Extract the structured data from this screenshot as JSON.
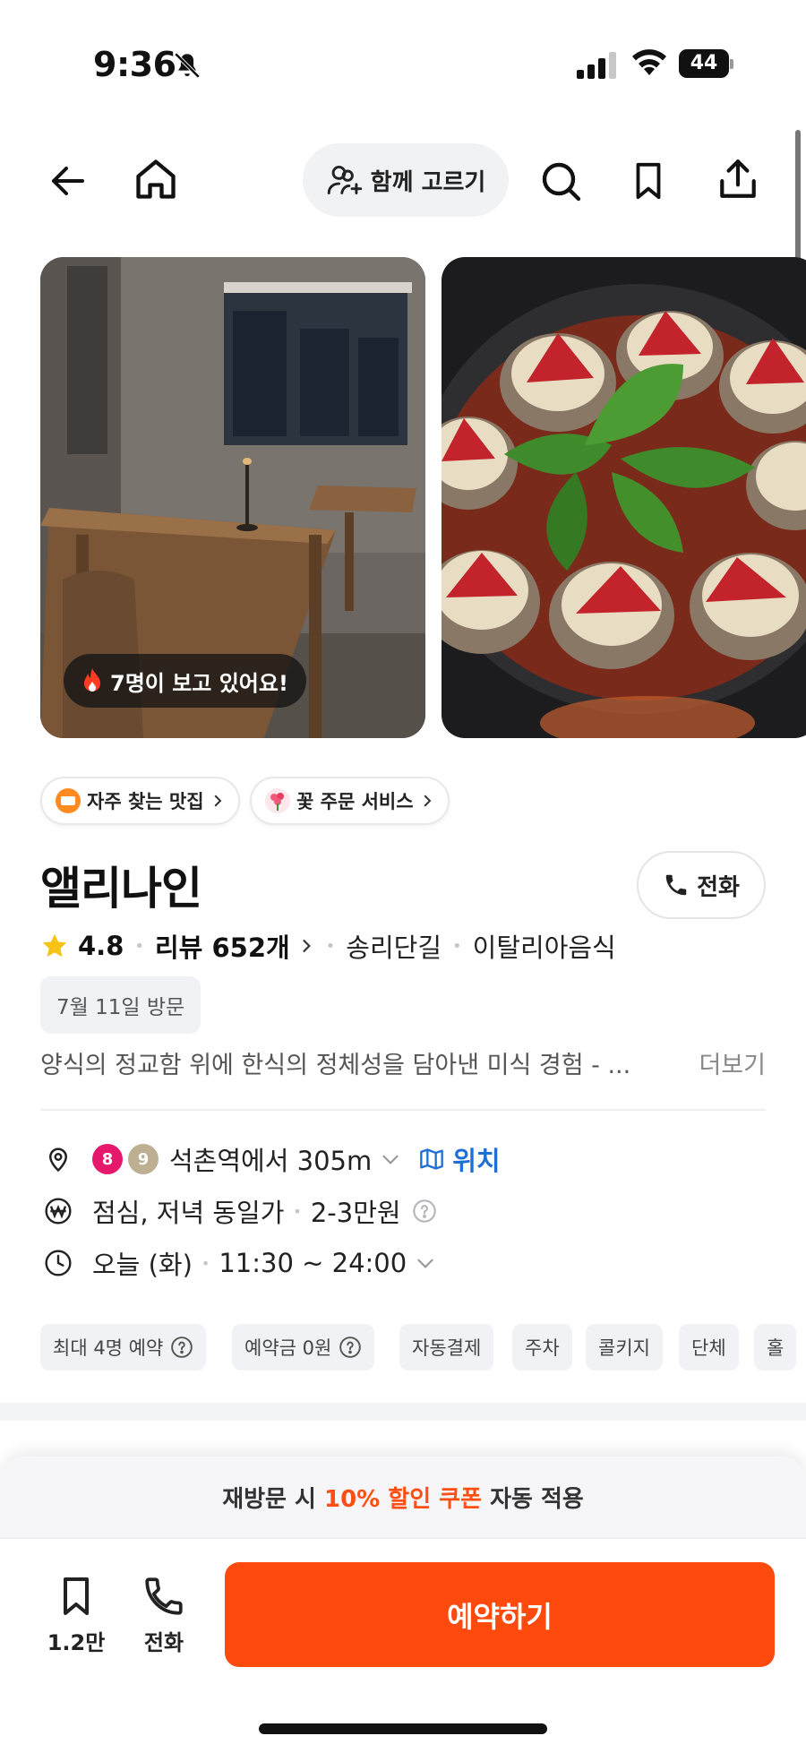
{
  "status_bar": {
    "time": "9:36",
    "battery": "44"
  },
  "nav": {
    "together_label": "함께 고르기"
  },
  "photos": {
    "viewers_text": "7명이 보고 있어요!"
  },
  "chips": [
    {
      "label": "자주 찾는 맛집"
    },
    {
      "label": "꽃 주문 서비스"
    }
  ],
  "restaurant": {
    "name": "앨리나인",
    "call_label": "전화",
    "rating": "4.8",
    "review_text": "리뷰 652개",
    "area": "송리단길",
    "category": "이탈리아음식",
    "visit_tag": "7월 11일 방문",
    "description": "양식의 정교함 위에 한식의 정체성을 담아낸 미식 경험  - ...",
    "more_label": "더보기"
  },
  "info": {
    "subway_lines": [
      {
        "num": "8",
        "color": "#e6186c"
      },
      {
        "num": "9",
        "color": "#bdb092"
      }
    ],
    "distance_text": "석촌역에서 305m",
    "location_label": "위치",
    "price_type": "점심, 저녁 동일가",
    "price_range": "2-3만원",
    "hours_day": "오늘 (화)",
    "hours_time": "11:30 ~ 24:00"
  },
  "tags": [
    {
      "label": "최대 4명 예약",
      "help": true
    },
    {
      "label": "예약금 0원",
      "help": true
    },
    {
      "label": "자동결제",
      "help": false
    },
    {
      "label": "주차",
      "help": false
    },
    {
      "label": "콜키지",
      "help": false
    },
    {
      "label": "단체",
      "help": false
    },
    {
      "label": "홀",
      "help": false
    }
  ],
  "bottom": {
    "coupon_prefix": "재방문 시 ",
    "coupon_highlight": "10% 할인 쿠폰",
    "coupon_suffix": " 자동 적용",
    "save_count": "1.2만",
    "call_label": "전화",
    "reserve_label": "예약하기"
  },
  "colors": {
    "accent": "#ff4a0d",
    "link": "#1f6fd6",
    "star": "#f6c416"
  }
}
